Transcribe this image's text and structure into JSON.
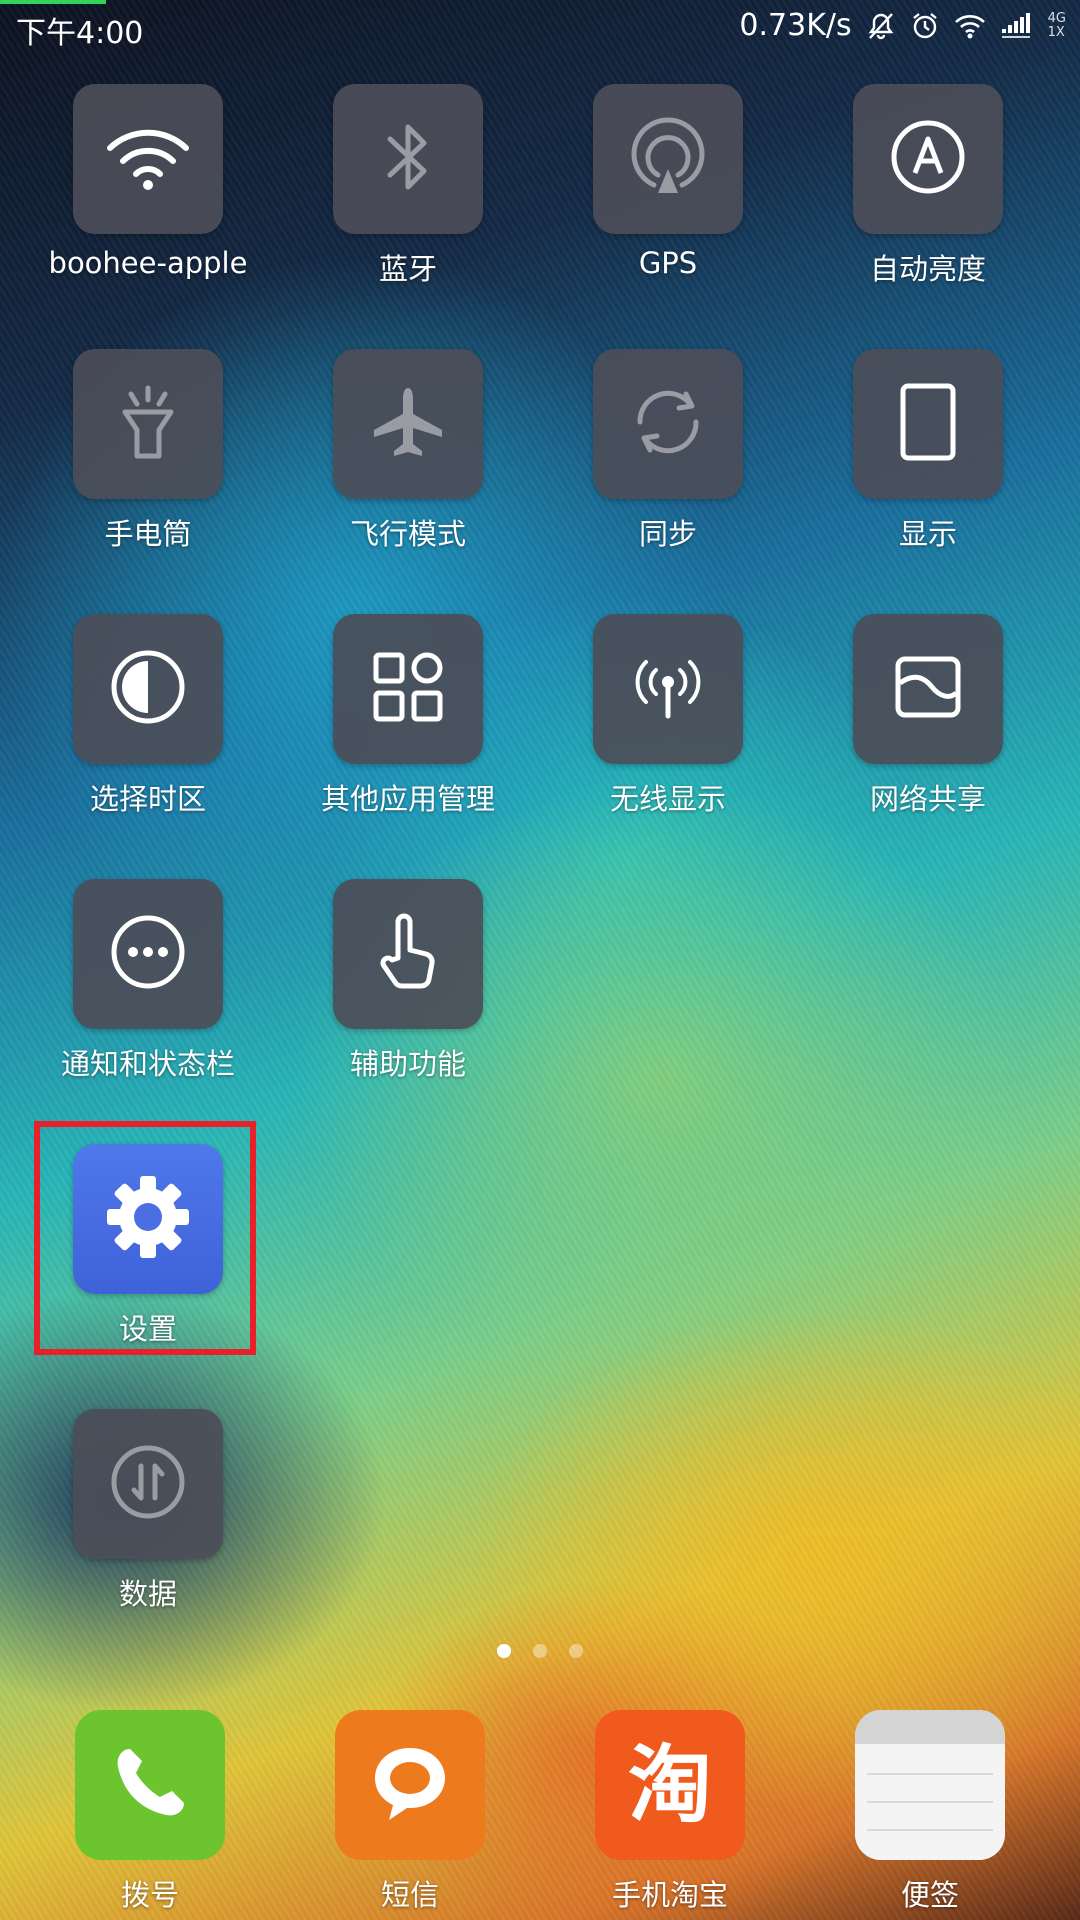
{
  "status_bar": {
    "time": "下午4:00",
    "net_speed": "0.73K/s",
    "network_type_top": "4G",
    "network_type_bottom": "1X",
    "icons": [
      "mute-icon",
      "alarm-icon",
      "wifi-icon",
      "signal-icon"
    ]
  },
  "toggles": [
    {
      "label": "boohee-apple",
      "icon": "wifi-icon"
    },
    {
      "label": "蓝牙",
      "icon": "bluetooth-icon"
    },
    {
      "label": "GPS",
      "icon": "gps-icon"
    },
    {
      "label": "自动亮度",
      "icon": "auto-brightness-icon"
    },
    {
      "label": "手电筒",
      "icon": "flashlight-icon"
    },
    {
      "label": "飞行模式",
      "icon": "airplane-icon"
    },
    {
      "label": "同步",
      "icon": "sync-icon"
    },
    {
      "label": "显示",
      "icon": "display-icon"
    },
    {
      "label": "选择时区",
      "icon": "timezone-icon"
    },
    {
      "label": "其他应用管理",
      "icon": "apps-grid-icon"
    },
    {
      "label": "无线显示",
      "icon": "wireless-display-icon"
    },
    {
      "label": "网络共享",
      "icon": "tethering-icon"
    },
    {
      "label": "通知和状态栏",
      "icon": "more-icon"
    },
    {
      "label": "辅助功能",
      "icon": "hand-pointer-icon"
    },
    {
      "label": "设置",
      "icon": "gear-icon",
      "highlighted": true
    },
    {
      "label": "数据",
      "icon": "data-icon"
    }
  ],
  "pager": {
    "count": 3,
    "active": 0
  },
  "dock": [
    {
      "label": "拨号",
      "icon": "phone-icon",
      "color": "#6cc42e"
    },
    {
      "label": "短信",
      "icon": "message-icon",
      "color": "#ee7a1e"
    },
    {
      "label": "手机淘宝",
      "icon": "taobao-icon",
      "icon_text": "淘",
      "color": "#f05a1c"
    },
    {
      "label": "便签",
      "icon": "notes-icon",
      "color": "#f2f2f2"
    }
  ],
  "colors": {
    "tile_background": "#4b4e58",
    "settings_tile": "#4a6fe3",
    "highlight_border": "#e8202a",
    "status_progress": "#35d25a"
  }
}
